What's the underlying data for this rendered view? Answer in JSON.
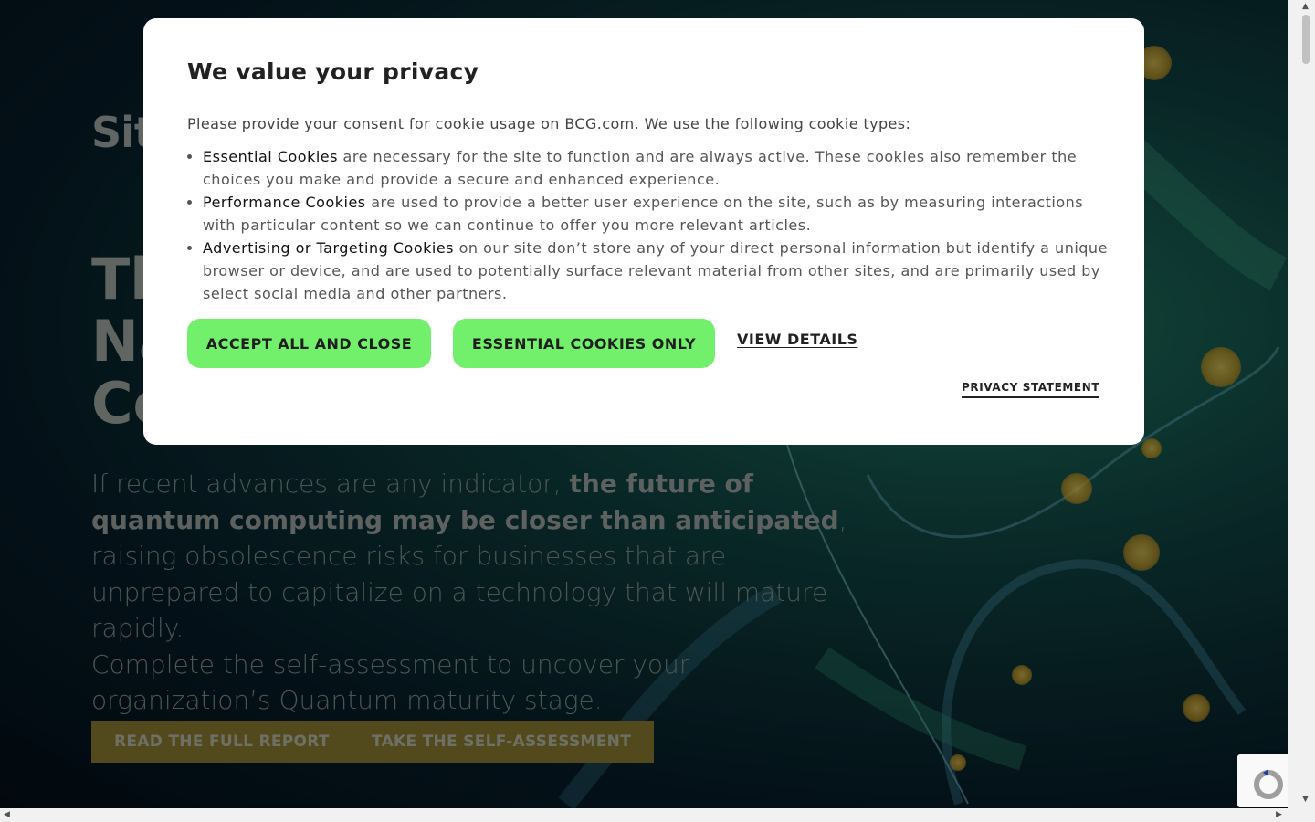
{
  "page": {
    "logo_text": "Site",
    "heading_lines": [
      "Th",
      "Na",
      "Co"
    ],
    "lead": {
      "p1_before": "If recent advances are any indicator, ",
      "p1_bold": "the future of quantum computing may be closer than anticipated",
      "p1_after": ", raising obsolescence risks for businesses that are unprepared to capitalize on a technology that will mature rapidly.",
      "p2": "Complete the self-assessment to uncover your organization’s Quantum maturity stage."
    },
    "cta": {
      "report_label": "READ THE FULL REPORT",
      "assess_label": "TAKE THE SELF-ASSESSMENT"
    }
  },
  "modal": {
    "title": "We value your privacy",
    "intro": "Please provide your consent for cookie usage on BCG.com. We use the following cookie types:",
    "cookie_types": [
      {
        "name": "Essential Cookies",
        "desc": " are necessary for the site to function and are always active. These cookies also remember the choices you make and provide a secure and enhanced experience."
      },
      {
        "name": "Performance Cookies",
        "desc": " are used to provide a better user experience on the site, such as by measuring interactions with particular content so we can continue to offer you more relevant articles."
      },
      {
        "name": "Advertising or Targeting Cookies",
        "desc": " on our site don’t store any of your direct personal information but identify a unique browser or device, and are used to potentially surface relevant material from other sites, and are primarily used by select social media and other partners."
      }
    ],
    "accept_label": "ACCEPT ALL AND CLOSE",
    "essential_label": "ESSENTIAL COOKIES ONLY",
    "details_label": "VIEW DETAILS",
    "privacy_label": "PRIVACY STATEMENT"
  },
  "colors": {
    "button_green": "#72f06b",
    "cta_gold": "#7a6d2c"
  },
  "icons": {
    "recaptcha": "recaptcha-icon"
  }
}
